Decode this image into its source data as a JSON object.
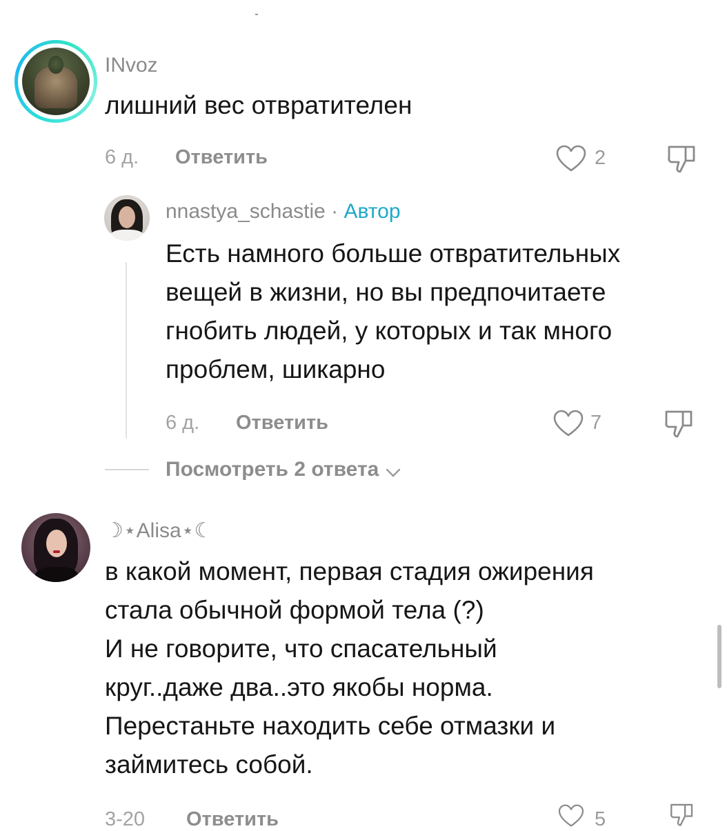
{
  "comments": [
    {
      "username": "INvoz",
      "text": "лишний вес отвратителен",
      "time": "6 д.",
      "reply_label": "Ответить",
      "likes": "2"
    },
    {
      "username": "nnastya_schastie",
      "separator": " · ",
      "author_badge": "Автор",
      "text_lines": [
        "Есть намного больше отвратительных",
        "вещей в жизни, но вы предпочитаете",
        "гнобить людей, у которых и так много",
        "проблем, шикарно"
      ],
      "time": "6 д.",
      "reply_label": "Ответить",
      "likes": "7"
    },
    {
      "username": "☽⋆Alisa⋆☾",
      "text_lines": [
        "в какой момент, первая стадия ожирения",
        "стала обычной формой тела (?)",
        "И не говорите, что спасательный",
        "круг..даже два..это якобы норма.",
        "Перестаньте находить себе отмазки и",
        "займитесь собой."
      ],
      "time": "3-20",
      "reply_label": "Ответить",
      "likes": "5"
    }
  ],
  "view_replies": "Посмотреть 2 ответа",
  "icons": {
    "like": "heart-outline-icon",
    "dislike": "thumbs-down-outline-icon",
    "expand": "chevron-down-icon"
  },
  "colors": {
    "author_badge": "#1da8c9",
    "avatar_ring": "#2be0d8"
  }
}
